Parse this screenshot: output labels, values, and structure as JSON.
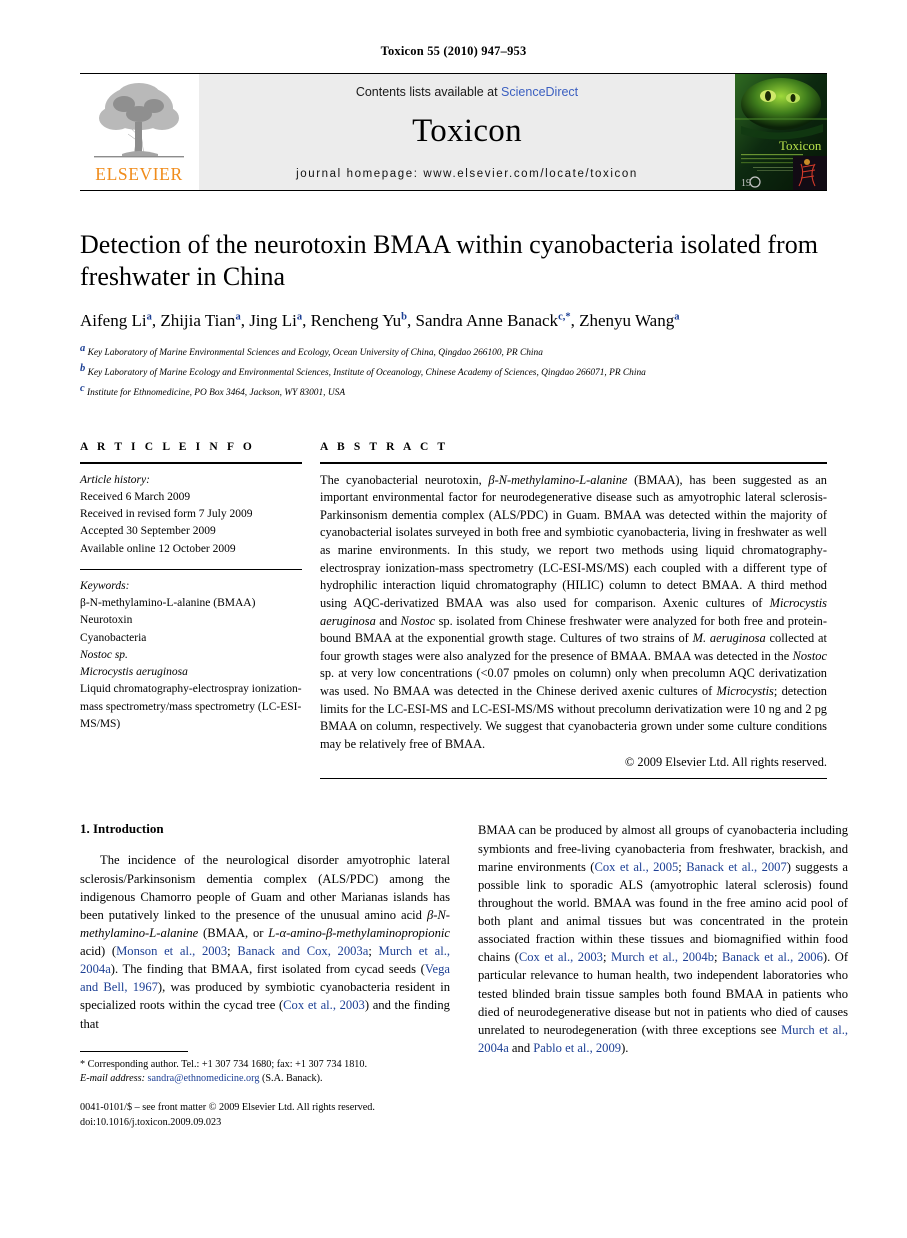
{
  "running_head": "Toxicon 55 (2010) 947–953",
  "masthead": {
    "contents_prefix": "Contents lists available at ",
    "sciencedirect": "ScienceDirect",
    "journal_name": "Toxicon",
    "homepage": "journal homepage: www.elsevier.com/locate/toxicon",
    "publisher_logo_text": "ELSEVIER",
    "cover_title": "Toxicon",
    "cover_subtitle": "An International Journal devoted to the exchange of knowledge on the poisons produced by animals, plants and microorganisms",
    "accent_blue": "#3b5fc0",
    "accent_orange": "#f08c1b"
  },
  "article": {
    "title": "Detection of the neurotoxin BMAA within cyanobacteria isolated from freshwater in China",
    "authors": [
      {
        "name": "Aifeng Li",
        "sup": "a"
      },
      {
        "name": "Zhijia Tian",
        "sup": "a"
      },
      {
        "name": "Jing Li",
        "sup": "a"
      },
      {
        "name": "Rencheng Yu",
        "sup": "b"
      },
      {
        "name": "Sandra Anne Banack",
        "sup": "c,*"
      },
      {
        "name": "Zhenyu Wang",
        "sup": "a"
      }
    ],
    "affiliations": [
      {
        "sup": "a",
        "text": "Key Laboratory of Marine Environmental Sciences and Ecology, Ocean University of China, Qingdao 266100, PR China"
      },
      {
        "sup": "b",
        "text": "Key Laboratory of Marine Ecology and Environmental Sciences, Institute of Oceanology, Chinese Academy of Sciences, Qingdao 266071, PR China"
      },
      {
        "sup": "c",
        "text": "Institute for Ethnomedicine, PO Box 3464, Jackson, WY 83001, USA"
      }
    ]
  },
  "article_info": {
    "heading": "A R T I C L E    I N F O",
    "history_label": "Article history:",
    "history": [
      "Received 6 March 2009",
      "Received in revised form 7 July 2009",
      "Accepted 30 September 2009",
      "Available online 12 October 2009"
    ],
    "keywords_label": "Keywords:",
    "keywords": [
      "β-N-methylamino-L-alanine (BMAA)",
      "Neurotoxin",
      "Cyanobacteria",
      "Nostoc sp.",
      "Microcystis aeruginosa",
      "Liquid chromatography-electrospray ionization-mass spectrometry/mass spectrometry (LC-ESI-MS/MS)"
    ]
  },
  "abstract": {
    "heading": "A B S T R A C T",
    "text": "The cyanobacterial neurotoxin, β-N-methylamino-L-alanine (BMAA), has been suggested as an important environmental factor for neurodegenerative disease such as amyotrophic lateral sclerosis- Parkinsonism dementia complex (ALS/PDC) in Guam. BMAA was detected within the majority of cyanobacterial isolates surveyed in both free and symbiotic cyanobacteria, living in freshwater as well as marine environments. In this study, we report two methods using liquid chromatography-electrospray ionization-mass spectrometry (LC-ESI-MS/MS) each coupled with a different type of hydrophilic interaction liquid chromatography (HILIC) column to detect BMAA. A third method using AQC-derivatized BMAA was also used for comparison. Axenic cultures of Microcystis aeruginosa and Nostoc sp. isolated from Chinese freshwater were analyzed for both free and protein-bound BMAA at the exponential growth stage. Cultures of two strains of M. aeruginosa collected at four growth stages were also analyzed for the presence of BMAA. BMAA was detected in the Nostoc sp. at very low concentrations (<0.07 pmoles on column) only when precolumn AQC derivatization was used. No BMAA was detected in the Chinese derived axenic cultures of Microcystis; detection limits for the LC-ESI-MS and LC-ESI-MS/MS without precolumn derivatization were 10 ng and 2 pg BMAA on column, respectively. We suggest that cyanobacteria grown under some culture conditions may be relatively free of BMAA.",
    "copyright": "© 2009 Elsevier Ltd. All rights reserved."
  },
  "introduction": {
    "number_title": "1.  Introduction",
    "left_paragraph": "The incidence of the neurological disorder amyotrophic lateral sclerosis/Parkinsonism dementia complex (ALS/PDC) among the indigenous Chamorro people of Guam and other Marianas islands has been putatively linked to the presence of the unusual amino acid β-N-methylamino-L-alanine (BMAA, or L-α-amino-β-methylaminopropionic acid) (Monson et al., 2003; Banack and Cox, 2003a; Murch et al., 2004a). The finding that BMAA, first isolated from cycad seeds (Vega and Bell, 1967), was produced by symbiotic cyanobacteria resident in specialized roots within the cycad tree (Cox et al., 2003) and the finding that",
    "right_paragraph": "BMAA can be produced by almost all groups of cyanobacteria including symbionts and free-living cyanobacteria from freshwater, brackish, and marine environments (Cox et al., 2005; Banack et al., 2007) suggests a possible link to sporadic ALS (amyotrophic lateral sclerosis) found throughout the world. BMAA was found in the free amino acid pool of both plant and animal tissues but was concentrated in the protein associated fraction within these tissues and biomagnified within food chains (Cox et al., 2003; Murch et al., 2004b; Banack et al., 2006). Of particular relevance to human health, two independent laboratories who tested blinded brain tissue samples both found BMAA in patients who died of neurodegenerative disease but not in patients who died of causes unrelated to neurodegeneration (with three exceptions see Murch et al., 2004a and Pablo et al., 2009)."
  },
  "footnote": {
    "corresponding": "* Corresponding author. Tel.: +1 307 734 1680; fax: +1 307 734 1810.",
    "email_label": "E-mail address:",
    "email": "sandra@ethnomedicine.org",
    "email_suffix": "(S.A. Banack).",
    "issn_line": "0041-0101/$ – see front matter © 2009 Elsevier Ltd. All rights reserved.",
    "doi_line": "doi:10.1016/j.toxicon.2009.09.023"
  }
}
